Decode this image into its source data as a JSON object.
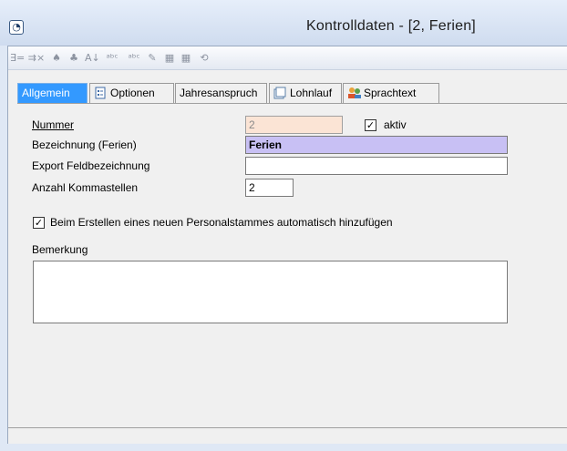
{
  "window": {
    "title": "Kontrolldaten - [2, Ferien]",
    "icon": "dialog-app-icon"
  },
  "toolbar": {
    "buttons": [
      {
        "icon": "insert-row-icon",
        "glyph": "→="
      },
      {
        "icon": "delete-row-icon",
        "glyph": "⇢✗"
      },
      {
        "icon": "move-up-icon",
        "glyph": "▲"
      },
      {
        "icon": "move-down-icon",
        "glyph": "▼"
      },
      {
        "icon": "sort-az-icon",
        "glyph": "A↓"
      },
      {
        "icon": "spellcheck-icon",
        "glyph": "abc"
      },
      {
        "icon": "spellcheck-options-icon",
        "glyph": "abc"
      },
      {
        "icon": "edit-note-icon",
        "glyph": "✎"
      },
      {
        "icon": "grid-view-icon",
        "glyph": "▓"
      },
      {
        "icon": "grid-edit-icon",
        "glyph": "▓"
      },
      {
        "icon": "history-icon",
        "glyph": "⟲"
      }
    ]
  },
  "tabs": [
    {
      "label": "Allgemein",
      "active": true
    },
    {
      "label": "Optionen",
      "icon": "options-icon"
    },
    {
      "label": "Jahresanspruch"
    },
    {
      "label": "Lohnlauf",
      "icon": "payroll-icon"
    },
    {
      "label": "Sprachtext",
      "icon": "language-people-icon"
    }
  ],
  "form": {
    "nummer_label": "Nummer",
    "nummer_value": "2",
    "aktiv_label": "aktiv",
    "aktiv_checked": true,
    "bezeichnung_label": "Bezeichnung (Ferien)",
    "bezeichnung_value": "Ferien",
    "export_label": "Export Feldbezeichnung",
    "export_value": "",
    "kommastellen_label": "Anzahl Kommastellen",
    "kommastellen_value": "2",
    "auto_add_label": "Beim Erstellen eines neuen Personalstammes automatisch hinzufügen",
    "auto_add_checked": true,
    "bemerkung_label": "Bemerkung",
    "bemerkung_value": ""
  },
  "colors": {
    "active_tab": "#3399ff",
    "readonly_field": "#fbe4d5",
    "highlight_field": "#c8c0f4"
  }
}
